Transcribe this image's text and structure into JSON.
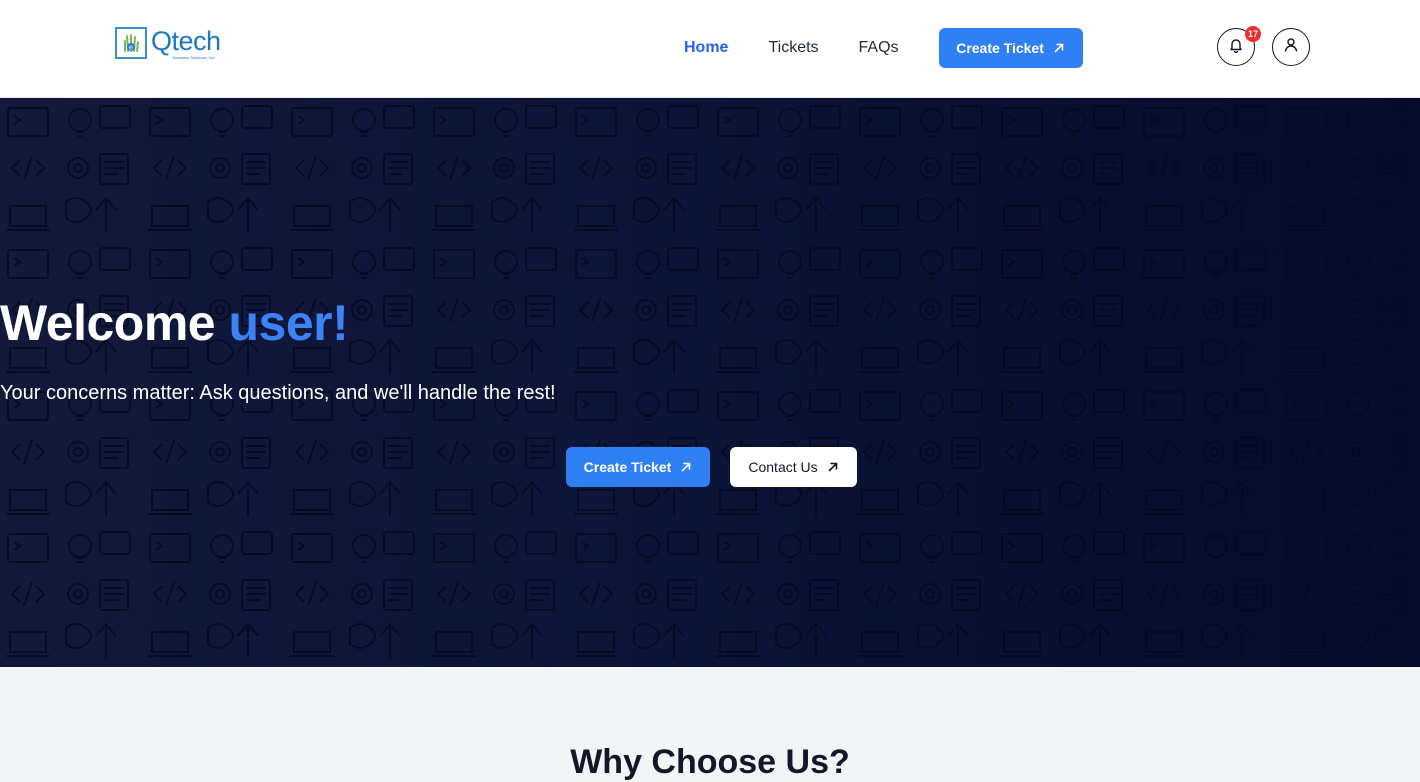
{
  "header": {
    "logo_text": "Qtech",
    "logo_sub": "Business Solutions, Inc.",
    "nav": [
      {
        "label": "Home",
        "active": true
      },
      {
        "label": "Tickets",
        "active": false
      },
      {
        "label": "FAQs",
        "active": false
      }
    ],
    "cta_label": "Create Ticket",
    "notification_count": "17"
  },
  "hero": {
    "title_prefix": "Welcome",
    "title_accent": "user!",
    "subtitle": "Your concerns matter: Ask questions, and we'll handle the rest!",
    "primary_button": "Create Ticket",
    "secondary_button": "Contact Us"
  },
  "section": {
    "heading": "Why Choose Us?"
  },
  "colors": {
    "accent": "#2f80f5",
    "hero_bg": "#0c1437",
    "badge": "#ef2f2f"
  },
  "icons": [
    "bell-icon",
    "user-icon",
    "arrow-up-right-icon"
  ]
}
